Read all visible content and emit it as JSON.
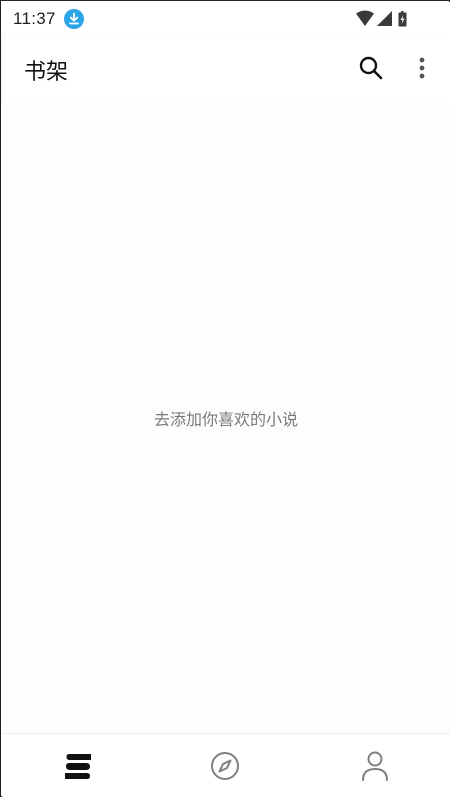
{
  "status_bar": {
    "time": "11:37",
    "icons": [
      "download-icon",
      "wifi-icon",
      "signal-icon",
      "battery-icon"
    ]
  },
  "app_bar": {
    "title": "书架",
    "actions": [
      "search-icon",
      "more-vert-icon"
    ]
  },
  "content": {
    "empty_message": "去添加你喜欢的小说"
  },
  "bottom_nav": {
    "items": [
      {
        "icon": "bookshelf-icon",
        "active": true
      },
      {
        "icon": "compass-icon",
        "active": false
      },
      {
        "icon": "person-icon",
        "active": false
      }
    ]
  },
  "colors": {
    "accent": "#2aa5e6",
    "active_icon": "#111111",
    "inactive_icon": "#808080"
  }
}
